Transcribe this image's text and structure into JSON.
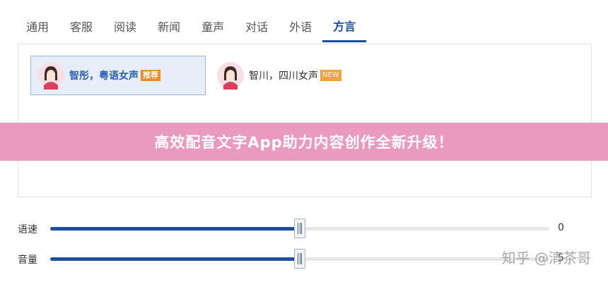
{
  "tabs": [
    {
      "label": "通用"
    },
    {
      "label": "客服"
    },
    {
      "label": "阅读"
    },
    {
      "label": "新闻"
    },
    {
      "label": "童声"
    },
    {
      "label": "对话"
    },
    {
      "label": "外语"
    },
    {
      "label": "方言",
      "active": true
    }
  ],
  "voices": [
    {
      "name": "智彤，粤语女声",
      "badge": "推荐",
      "selected": true,
      "avatar": "female-avatar-icon"
    },
    {
      "name": "智川，四川女声",
      "badge": "NEW",
      "selected": false,
      "avatar": "female-avatar-icon"
    }
  ],
  "banner": {
    "text": "高效配音文字App助力内容创作全新升级！"
  },
  "sliders": {
    "speed": {
      "label": "语速",
      "value": "0",
      "level": 0.5
    },
    "volume": {
      "label": "音量",
      "value": "5",
      "level": 0.5
    }
  },
  "watermark": {
    "text": "知乎 @清茶哥"
  },
  "colors": {
    "accent": "#1e4f9c",
    "banner": "#e892ba",
    "badge_recommend": "#f08a24",
    "badge_new": "#f6a23a"
  }
}
